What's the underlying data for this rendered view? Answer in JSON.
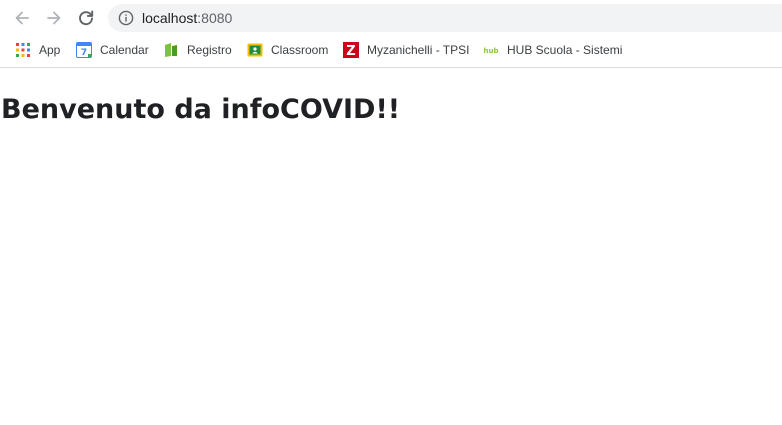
{
  "browser": {
    "url_host": "localhost",
    "url_port": ":8080",
    "bookmarks": [
      {
        "label": "App",
        "icon": "apps-grid-icon"
      },
      {
        "label": "Calendar",
        "icon": "calendar-icon"
      },
      {
        "label": "Registro",
        "icon": "registro-icon"
      },
      {
        "label": "Classroom",
        "icon": "classroom-icon"
      },
      {
        "label": "Myzanichelli - TPSI",
        "icon": "zanichelli-icon"
      },
      {
        "label": "HUB Scuola - Sistemi",
        "icon": "hub-icon"
      }
    ],
    "calendar_icon_day": "7",
    "zanichelli_icon_letter": "Z",
    "hub_icon_text": "hub"
  },
  "page": {
    "heading": "Benvenuto da infoCOVID!!"
  },
  "colors": {
    "toolbar_icon": "#5f6368",
    "omnibox_bg": "#f1f3f4",
    "text": "#202124"
  }
}
